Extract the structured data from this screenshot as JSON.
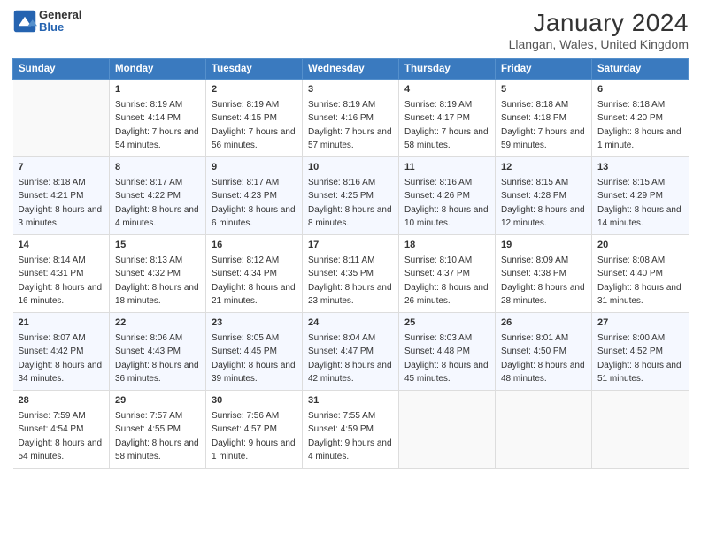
{
  "header": {
    "logo_general": "General",
    "logo_blue": "Blue",
    "title": "January 2024",
    "subtitle": "Llangan, Wales, United Kingdom"
  },
  "columns": [
    "Sunday",
    "Monday",
    "Tuesday",
    "Wednesday",
    "Thursday",
    "Friday",
    "Saturday"
  ],
  "rows": [
    [
      {
        "day": "",
        "sunrise": "",
        "sunset": "",
        "daylight": "",
        "empty": true
      },
      {
        "day": "1",
        "sunrise": "Sunrise: 8:19 AM",
        "sunset": "Sunset: 4:14 PM",
        "daylight": "Daylight: 7 hours and 54 minutes."
      },
      {
        "day": "2",
        "sunrise": "Sunrise: 8:19 AM",
        "sunset": "Sunset: 4:15 PM",
        "daylight": "Daylight: 7 hours and 56 minutes."
      },
      {
        "day": "3",
        "sunrise": "Sunrise: 8:19 AM",
        "sunset": "Sunset: 4:16 PM",
        "daylight": "Daylight: 7 hours and 57 minutes."
      },
      {
        "day": "4",
        "sunrise": "Sunrise: 8:19 AM",
        "sunset": "Sunset: 4:17 PM",
        "daylight": "Daylight: 7 hours and 58 minutes."
      },
      {
        "day": "5",
        "sunrise": "Sunrise: 8:18 AM",
        "sunset": "Sunset: 4:18 PM",
        "daylight": "Daylight: 7 hours and 59 minutes."
      },
      {
        "day": "6",
        "sunrise": "Sunrise: 8:18 AM",
        "sunset": "Sunset: 4:20 PM",
        "daylight": "Daylight: 8 hours and 1 minute."
      }
    ],
    [
      {
        "day": "7",
        "sunrise": "Sunrise: 8:18 AM",
        "sunset": "Sunset: 4:21 PM",
        "daylight": "Daylight: 8 hours and 3 minutes."
      },
      {
        "day": "8",
        "sunrise": "Sunrise: 8:17 AM",
        "sunset": "Sunset: 4:22 PM",
        "daylight": "Daylight: 8 hours and 4 minutes."
      },
      {
        "day": "9",
        "sunrise": "Sunrise: 8:17 AM",
        "sunset": "Sunset: 4:23 PM",
        "daylight": "Daylight: 8 hours and 6 minutes."
      },
      {
        "day": "10",
        "sunrise": "Sunrise: 8:16 AM",
        "sunset": "Sunset: 4:25 PM",
        "daylight": "Daylight: 8 hours and 8 minutes."
      },
      {
        "day": "11",
        "sunrise": "Sunrise: 8:16 AM",
        "sunset": "Sunset: 4:26 PM",
        "daylight": "Daylight: 8 hours and 10 minutes."
      },
      {
        "day": "12",
        "sunrise": "Sunrise: 8:15 AM",
        "sunset": "Sunset: 4:28 PM",
        "daylight": "Daylight: 8 hours and 12 minutes."
      },
      {
        "day": "13",
        "sunrise": "Sunrise: 8:15 AM",
        "sunset": "Sunset: 4:29 PM",
        "daylight": "Daylight: 8 hours and 14 minutes."
      }
    ],
    [
      {
        "day": "14",
        "sunrise": "Sunrise: 8:14 AM",
        "sunset": "Sunset: 4:31 PM",
        "daylight": "Daylight: 8 hours and 16 minutes."
      },
      {
        "day": "15",
        "sunrise": "Sunrise: 8:13 AM",
        "sunset": "Sunset: 4:32 PM",
        "daylight": "Daylight: 8 hours and 18 minutes."
      },
      {
        "day": "16",
        "sunrise": "Sunrise: 8:12 AM",
        "sunset": "Sunset: 4:34 PM",
        "daylight": "Daylight: 8 hours and 21 minutes."
      },
      {
        "day": "17",
        "sunrise": "Sunrise: 8:11 AM",
        "sunset": "Sunset: 4:35 PM",
        "daylight": "Daylight: 8 hours and 23 minutes."
      },
      {
        "day": "18",
        "sunrise": "Sunrise: 8:10 AM",
        "sunset": "Sunset: 4:37 PM",
        "daylight": "Daylight: 8 hours and 26 minutes."
      },
      {
        "day": "19",
        "sunrise": "Sunrise: 8:09 AM",
        "sunset": "Sunset: 4:38 PM",
        "daylight": "Daylight: 8 hours and 28 minutes."
      },
      {
        "day": "20",
        "sunrise": "Sunrise: 8:08 AM",
        "sunset": "Sunset: 4:40 PM",
        "daylight": "Daylight: 8 hours and 31 minutes."
      }
    ],
    [
      {
        "day": "21",
        "sunrise": "Sunrise: 8:07 AM",
        "sunset": "Sunset: 4:42 PM",
        "daylight": "Daylight: 8 hours and 34 minutes."
      },
      {
        "day": "22",
        "sunrise": "Sunrise: 8:06 AM",
        "sunset": "Sunset: 4:43 PM",
        "daylight": "Daylight: 8 hours and 36 minutes."
      },
      {
        "day": "23",
        "sunrise": "Sunrise: 8:05 AM",
        "sunset": "Sunset: 4:45 PM",
        "daylight": "Daylight: 8 hours and 39 minutes."
      },
      {
        "day": "24",
        "sunrise": "Sunrise: 8:04 AM",
        "sunset": "Sunset: 4:47 PM",
        "daylight": "Daylight: 8 hours and 42 minutes."
      },
      {
        "day": "25",
        "sunrise": "Sunrise: 8:03 AM",
        "sunset": "Sunset: 4:48 PM",
        "daylight": "Daylight: 8 hours and 45 minutes."
      },
      {
        "day": "26",
        "sunrise": "Sunrise: 8:01 AM",
        "sunset": "Sunset: 4:50 PM",
        "daylight": "Daylight: 8 hours and 48 minutes."
      },
      {
        "day": "27",
        "sunrise": "Sunrise: 8:00 AM",
        "sunset": "Sunset: 4:52 PM",
        "daylight": "Daylight: 8 hours and 51 minutes."
      }
    ],
    [
      {
        "day": "28",
        "sunrise": "Sunrise: 7:59 AM",
        "sunset": "Sunset: 4:54 PM",
        "daylight": "Daylight: 8 hours and 54 minutes."
      },
      {
        "day": "29",
        "sunrise": "Sunrise: 7:57 AM",
        "sunset": "Sunset: 4:55 PM",
        "daylight": "Daylight: 8 hours and 58 minutes."
      },
      {
        "day": "30",
        "sunrise": "Sunrise: 7:56 AM",
        "sunset": "Sunset: 4:57 PM",
        "daylight": "Daylight: 9 hours and 1 minute."
      },
      {
        "day": "31",
        "sunrise": "Sunrise: 7:55 AM",
        "sunset": "Sunset: 4:59 PM",
        "daylight": "Daylight: 9 hours and 4 minutes."
      },
      {
        "day": "",
        "sunrise": "",
        "sunset": "",
        "daylight": "",
        "empty": true
      },
      {
        "day": "",
        "sunrise": "",
        "sunset": "",
        "daylight": "",
        "empty": true
      },
      {
        "day": "",
        "sunrise": "",
        "sunset": "",
        "daylight": "",
        "empty": true
      }
    ]
  ]
}
